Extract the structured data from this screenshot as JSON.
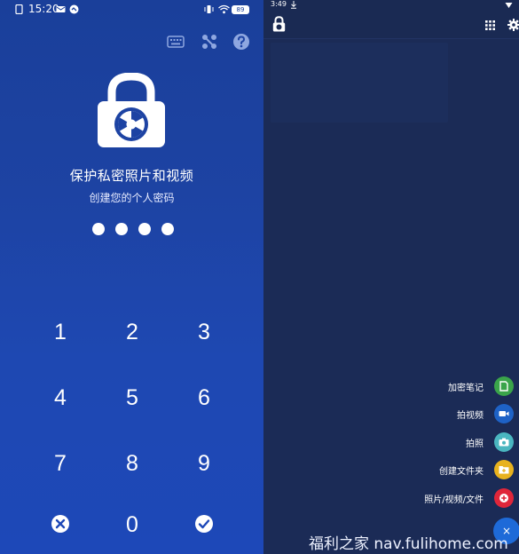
{
  "left": {
    "status": {
      "time": "15:20",
      "battery": "89"
    },
    "toolbar": {
      "icons": [
        "keyboard-icon",
        "pattern-icon",
        "help-icon"
      ]
    },
    "title": "保护私密照片和视频",
    "subtitle": "创建您的个人密码",
    "pin_dots": 4,
    "keypad": {
      "k1": "1",
      "k2": "2",
      "k3": "3",
      "k4": "4",
      "k5": "5",
      "k6": "6",
      "k7": "7",
      "k8": "8",
      "k9": "9",
      "k0": "0"
    }
  },
  "right": {
    "status": {
      "time": "3:49"
    },
    "fab_menu": {
      "items": [
        {
          "label": "加密笔记",
          "color": "#3aa44a",
          "icon": "note-icon"
        },
        {
          "label": "拍视频",
          "color": "#1e62c6",
          "icon": "video-camera-icon"
        },
        {
          "label": "拍照",
          "color": "#4ab6c0",
          "icon": "camera-icon"
        },
        {
          "label": "创建文件夹",
          "color": "#e8b21e",
          "icon": "folder-add-icon"
        },
        {
          "label": "照片/视频/文件",
          "color": "#e0263a",
          "icon": "add-media-icon"
        }
      ],
      "close": "×"
    }
  },
  "watermark": "福利之家  nav.fulihome.com",
  "colors": {
    "left_bg": "#1d43a3",
    "right_bg": "#1b2b56",
    "fab_blue": "#1e6ad8"
  }
}
